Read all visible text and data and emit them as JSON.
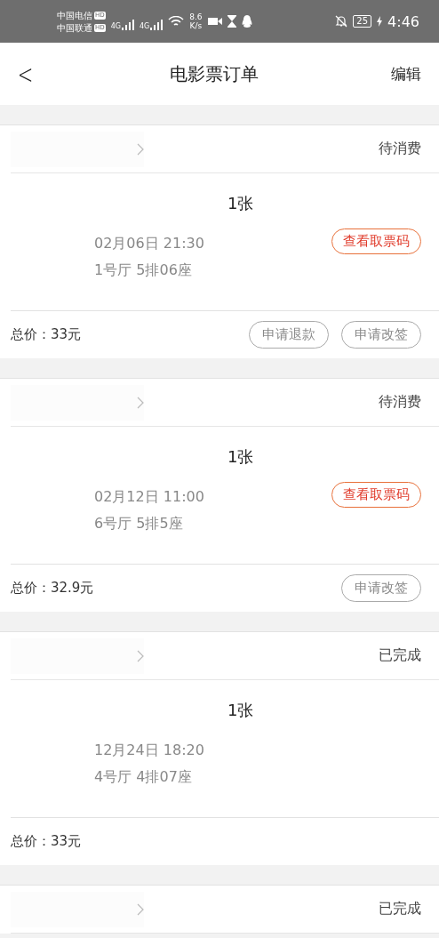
{
  "status_bar": {
    "carriers": [
      {
        "name": "中国电信",
        "badge": "HD"
      },
      {
        "name": "中国联通",
        "badge": "HD"
      }
    ],
    "signals": [
      "4G",
      "4G"
    ],
    "speed_value": "8.6",
    "speed_unit": "K/s",
    "battery": "25",
    "time": "4:46"
  },
  "nav": {
    "back": "<",
    "title": "电影票订单",
    "action": "编辑"
  },
  "orders": [
    {
      "status": "待消费",
      "count": "1张",
      "datetime": "02月06日 21:30",
      "seat": "1号厅 5排06座",
      "code_button": "查看取票码",
      "total": "总价：33元",
      "actions": [
        "申请退款",
        "申请改签"
      ]
    },
    {
      "status": "待消费",
      "count": "1张",
      "datetime": "02月12日 11:00",
      "seat": "6号厅 5排5座",
      "code_button": "查看取票码",
      "total": "总价：32.9元",
      "actions": [
        "申请改签"
      ]
    },
    {
      "status": "已完成",
      "count": "1张",
      "datetime": "12月24日 18:20",
      "seat": "4号厅 4排07座",
      "total": "总价：33元"
    },
    {
      "status": "已完成"
    }
  ]
}
